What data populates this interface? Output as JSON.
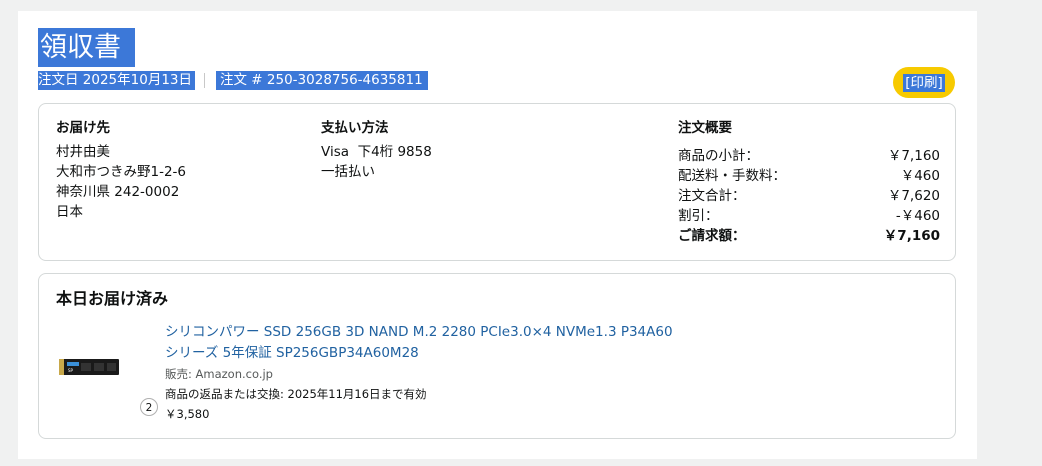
{
  "header": {
    "title": "領収書",
    "order_date": "注文日 2025年10月13日",
    "order_number": "注文 # 250-3028756-4635811",
    "print_label": "[印刷]"
  },
  "shipping": {
    "heading": "お届け先",
    "lines": [
      "村井由美",
      "大和市つきみ野1-2-6",
      "神奈川県 242-0002",
      "日本"
    ]
  },
  "payment": {
    "heading": "支払い方法",
    "lines": [
      "Visa  下4桁 9858",
      "一括払い"
    ]
  },
  "summary": {
    "heading": "注文概要",
    "rows": [
      {
        "label": "商品の小計：",
        "value": "￥7,160"
      },
      {
        "label": "配送料・手数料：",
        "value": "￥460"
      },
      {
        "label": "注文合計：",
        "value": "￥7,620"
      },
      {
        "label": "割引：",
        "value": "-￥460"
      },
      {
        "label": "ご請求額：",
        "value": "￥7,160"
      }
    ]
  },
  "delivery": {
    "heading": "本日お届け済み",
    "item": {
      "name_line1": "シリコンパワー SSD 256GB 3D NAND M.2 2280 PCIe3.0×4 NVMe1.3 P34A60",
      "name_line2": "シリーズ 5年保証 SP256GBP34A60M28",
      "seller": "販売: Amazon.co.jp",
      "return_info": "商品の返品または交換: 2025年11月16日まで有効",
      "price": "￥3,580",
      "quantity": "2",
      "thumb_label": "SP"
    }
  },
  "colors": {
    "selection": "#3c78d8",
    "print_button": "#f7ca00",
    "link": "#2162a1",
    "border": "#d5d9d9"
  }
}
